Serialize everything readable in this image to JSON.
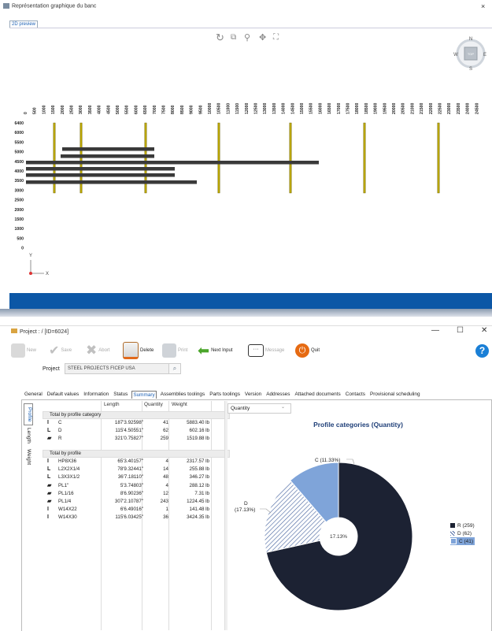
{
  "top_window": {
    "title": "Représentation graphique du banc",
    "close": "×",
    "tab": "2D preview",
    "compass": {
      "n": "N",
      "s": "S",
      "e": "E",
      "w": "W",
      "center": "TOP"
    },
    "axis": {
      "x": "X",
      "y": "Y"
    },
    "ruler_labels": [
      "0",
      "500",
      "1000",
      "1500",
      "2000",
      "2500",
      "3000",
      "3500",
      "4000",
      "4500",
      "5000",
      "5500",
      "6000",
      "6500",
      "7000",
      "7500",
      "8000",
      "8500",
      "9000",
      "9500",
      "10000",
      "10500",
      "11000",
      "11500",
      "12000",
      "12500",
      "13000",
      "13500",
      "14000",
      "14500",
      "15000",
      "15500",
      "16000",
      "16500",
      "17000",
      "17500",
      "18000",
      "18500",
      "19000",
      "19500",
      "20000",
      "20500",
      "21000",
      "21500",
      "22000",
      "22500",
      "23000",
      "23500",
      "24000",
      "24500"
    ],
    "y_labels": [
      "6400",
      "6000",
      "5500",
      "5000",
      "4500",
      "4000",
      "3500",
      "3000",
      "2500",
      "2000",
      "1500",
      "1000",
      "500",
      "0"
    ],
    "icons": [
      "rotate-icon",
      "zoom-window-icon",
      "zoom-icon",
      "pan-icon",
      "fit-icon"
    ]
  },
  "bottom_window": {
    "title": "Project :  /  [ID=6024]",
    "controls": {
      "min": "—",
      "max": "☐",
      "close": "✕"
    },
    "toolbar": {
      "new": "New",
      "save": "Save",
      "abort": "Abort",
      "delete": "Delete",
      "print": "Print",
      "next_input": "Next Input",
      "message": "Message",
      "quit": "Quit"
    },
    "project_label": "Project",
    "project_value": "STEEL PROJECTS FICEP USA",
    "tabs": [
      "General",
      "Default values",
      "Information",
      "Status",
      "Summary",
      "Assemblies toolings",
      "Parts toolings",
      "Version",
      "Addresses",
      "Attached documents",
      "Contacts",
      "Provisional scheduling"
    ],
    "active_tab": "Summary",
    "vtabs": {
      "profile": "Profile",
      "length": "Length",
      "weight": "Weight"
    },
    "table": {
      "headers": {
        "length": "Length",
        "quantity": "Quantity",
        "weight": "Weight"
      },
      "group1": "Total by profile category",
      "category_rows": [
        {
          "icon": "I",
          "name": "C",
          "length": "187'3.92598\"",
          "quantity": "41",
          "weight": "5883.40 lb"
        },
        {
          "icon": "L",
          "name": "D",
          "length": "115'4.50551\"",
          "quantity": "62",
          "weight": "602.16 lb"
        },
        {
          "icon": "▰",
          "name": "R",
          "length": "321'0.75827\"",
          "quantity": "259",
          "weight": "1519.88 lb"
        }
      ],
      "group2": "Total by profile",
      "profile_rows": [
        {
          "icon": "I",
          "name": "HP8X36",
          "length": "65'3.40157\"",
          "quantity": "4",
          "weight": "2317.57 lb"
        },
        {
          "icon": "L",
          "name": "L2X2X1/4",
          "length": "78'9.32441\"",
          "quantity": "14",
          "weight": "255.88 lb"
        },
        {
          "icon": "L",
          "name": "L3X3X1/2",
          "length": "36'7.18110\"",
          "quantity": "48",
          "weight": "346.27 lb"
        },
        {
          "icon": "▰",
          "name": "PL1\"",
          "length": "5'3.74803\"",
          "quantity": "4",
          "weight": "288.12 lb"
        },
        {
          "icon": "▰",
          "name": "PL1/16",
          "length": "8'6.90236\"",
          "quantity": "12",
          "weight": "7.31 lb"
        },
        {
          "icon": "▰",
          "name": "PL1/4",
          "length": "307'2.10787\"",
          "quantity": "243",
          "weight": "1224.45 lb"
        },
        {
          "icon": "I",
          "name": "W14X22",
          "length": "6'6.49016\"",
          "quantity": "1",
          "weight": "141.48 lb"
        },
        {
          "icon": "I",
          "name": "W14X30",
          "length": "115'6.03425\"",
          "quantity": "36",
          "weight": "3424.35 lb"
        }
      ]
    },
    "chart_select": "Quantity"
  },
  "chart_data": {
    "type": "pie",
    "title": "Profile categories (Quantity)",
    "categories": [
      "R",
      "D",
      "C"
    ],
    "values": [
      259,
      62,
      41
    ],
    "legend": [
      "R (259)",
      "D (62)",
      "C (41)"
    ],
    "slice_labels": {
      "C": "C (11.33%)",
      "D": "D\n(17.13%)"
    },
    "center_label": "17.13%",
    "legend_position": "right",
    "colors": {
      "R": "#1c2233",
      "D": "#ffffff",
      "C": "#7fa4d9"
    }
  },
  "colors": {
    "accent_blue": "#0c57a6",
    "yellow_post": "#b8a400",
    "bar": "#3a3a3a"
  }
}
